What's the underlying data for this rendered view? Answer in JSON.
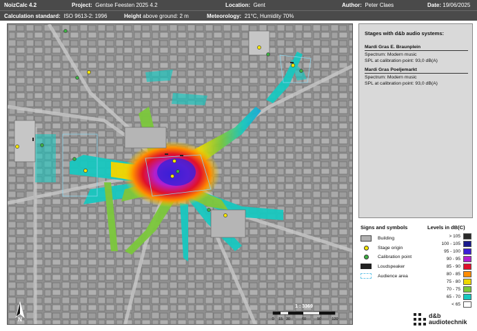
{
  "header": {
    "app": "NoizCalc 4.2",
    "project_label": "Project:",
    "project": "Gentse Feesten 2025 4.2",
    "location_label": "Location:",
    "location": "Gent",
    "author_label": "Author:",
    "author": "Peter Claes",
    "date_label": "Date:",
    "date": "19/06/2025",
    "standard_label": "Calculation standard:",
    "standard": "ISO 9613-2: 1996",
    "height_label": "Height",
    "height_text": "above ground: 2 m",
    "meteo_label": "Meteorology:",
    "meteo": "21°C, Humidity 70%"
  },
  "stages_panel": {
    "title": "Stages with d&b audio systems:",
    "stages": [
      {
        "name": "Mardi Gras E. Braunplein",
        "spectrum": "Spectrum:  Modern music",
        "spl": "SPL at calibration point:  93,0 dB(A)"
      },
      {
        "name": "Mardi Gras Poeljemarkt",
        "spectrum": "Spectrum:  Modern music",
        "spl": "SPL at calibration point:  93,0 dB(A)"
      }
    ]
  },
  "symbols": {
    "title": "Signs and symbols",
    "items": [
      {
        "label": "Building",
        "icon": "building-swatch"
      },
      {
        "label": "Stage origin",
        "icon": "stage-origin-dot",
        "color": "#f5e600"
      },
      {
        "label": "Calibration point",
        "icon": "calibration-dot",
        "color": "#3cb043"
      },
      {
        "label": "Loudspeaker",
        "icon": "loudspeaker-bar"
      },
      {
        "label": "Audience area",
        "icon": "audience-area-outline"
      }
    ]
  },
  "levels": {
    "title": "Levels in dB(C)",
    "items": [
      {
        "label": "> 105",
        "color": "#2a2a2a"
      },
      {
        "label": "100 - 105",
        "color": "#1a1a8c"
      },
      {
        "label": "95 - 100",
        "color": "#3b1fd6"
      },
      {
        "label": "90 - 95",
        "color": "#b21fd0"
      },
      {
        "label": "85 - 90",
        "color": "#e0102a"
      },
      {
        "label": "80 - 85",
        "color": "#ff8c00"
      },
      {
        "label": "75 - 80",
        "color": "#f0d800"
      },
      {
        "label": "70 - 75",
        "color": "#7cc83c"
      },
      {
        "label": "65 - 70",
        "color": "#18c8c0"
      },
      {
        "label": "< 65",
        "color": "#ffffff"
      }
    ]
  },
  "map": {
    "scale": "1 : 3369",
    "scale_ticks": [
      "0",
      "15",
      "30",
      "60",
      "90",
      "120"
    ],
    "north": "N"
  },
  "logo": {
    "line1": "d&b",
    "line2": "audiotechnik"
  }
}
